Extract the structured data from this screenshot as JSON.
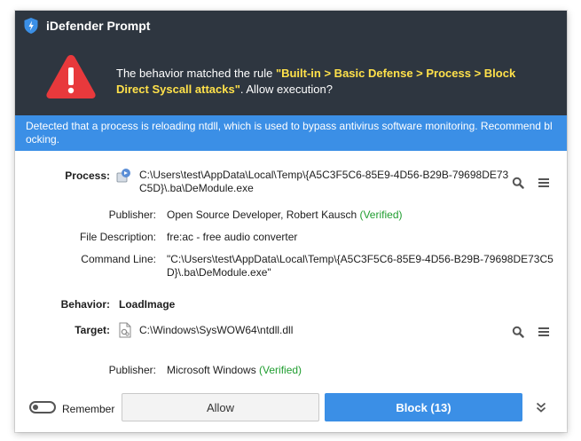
{
  "app": {
    "title": "iDefender Prompt"
  },
  "alert": {
    "prefix": "The behavior matched the rule ",
    "rule": "\"Built-in > Basic Defense > Process > Block Direct Syscall attacks\"",
    "suffix": ". Allow execution?"
  },
  "banner": {
    "text": "Detected that a process is reloading ntdll, which is used to bypass antivirus software monitoring. Recommend blocking."
  },
  "details": {
    "process_label": "Process:",
    "process_path": "C:\\Users\\test\\AppData\\Local\\Temp\\{A5C3F5C6-85E9-4D56-B29B-79698DE73C5D}\\.ba\\DeModule.exe",
    "publisher_label": "Publisher:",
    "publisher_name": "Open Source Developer, Robert Kausch",
    "publisher_verified": "(Verified)",
    "description_label": "File Description:",
    "description_value": "fre:ac - free audio converter",
    "cmdline_label": "Command Line:",
    "cmdline_value": "\"C:\\Users\\test\\AppData\\Local\\Temp\\{A5C3F5C6-85E9-4D56-B29B-79698DE73C5D}\\.ba\\DeModule.exe\"",
    "behavior_label": "Behavior:",
    "behavior_value": "LoadImage",
    "target_label": "Target:",
    "target_path": "C:\\Windows\\SysWOW64\\ntdll.dll",
    "target_publisher_label": "Publisher:",
    "target_publisher_name": "Microsoft Windows",
    "target_publisher_verified": "(Verified)"
  },
  "footer": {
    "remember_label": "Remember",
    "remember_checked": false,
    "allow_label": "Allow",
    "block_label": "Block (13)"
  },
  "colors": {
    "titlebar": "#2e3640",
    "banner": "#3b8fe6",
    "highlight": "#ffe14a",
    "verified": "#1f9d2f",
    "block_button": "#3b8fe6"
  },
  "icons": {
    "app_logo": "shield-icon",
    "warning": "warning-triangle-icon",
    "process_file": "application-file-icon",
    "target_file": "dll-file-icon",
    "search": "search-icon",
    "menu": "menu-icon",
    "expand": "double-chevron-down-icon"
  }
}
